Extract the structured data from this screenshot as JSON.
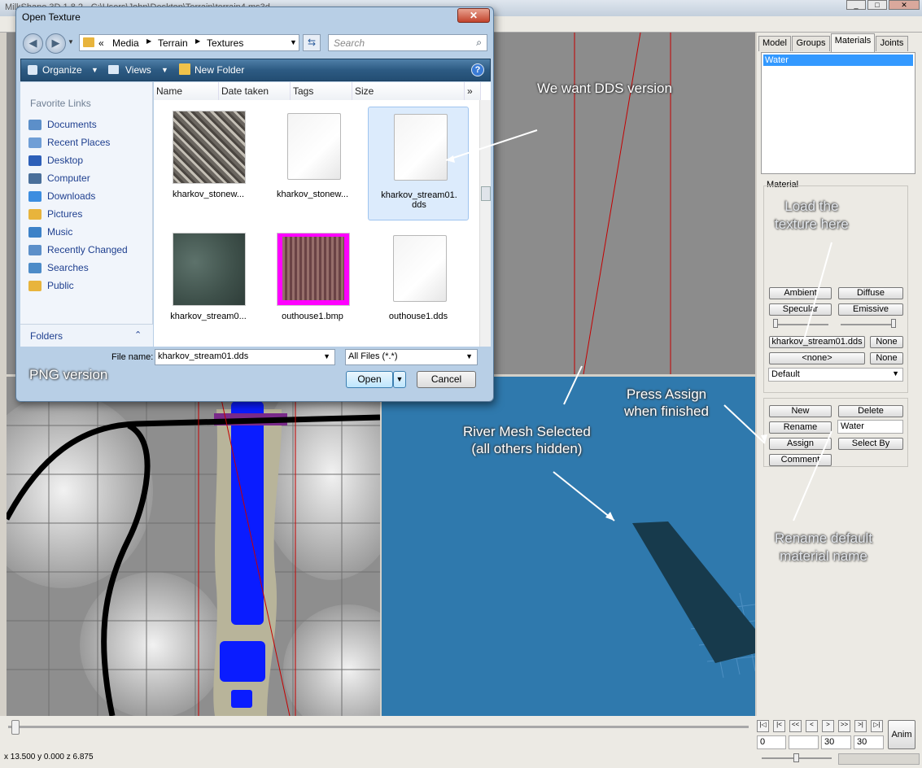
{
  "app": {
    "title": "MilkShape 3D 1.8.2 - C:\\Users\\John\\Desktop\\Terrain\\terrain4.ms3d",
    "minimize": "_",
    "maximize": "□",
    "close": "✕"
  },
  "panel": {
    "tabs": [
      "Model",
      "Groups",
      "Materials",
      "Joints"
    ],
    "materials_list": [
      "Water"
    ],
    "material_group_label": "Material",
    "buttons": {
      "ambient": "Ambient",
      "diffuse": "Diffuse",
      "specular": "Specular",
      "emissive": "Emissive",
      "texture": "kharkov_stream01.dds",
      "texture_none": "None",
      "alpha_map": "<none>",
      "alpha_none": "None",
      "mode": "Default",
      "new": "New",
      "delete": "Delete",
      "rename": "Rename",
      "assign": "Assign",
      "select_by": "Select By",
      "comment": "Comment"
    },
    "name_value": "Water"
  },
  "bottom": {
    "status": "x 13.500 y 0.000 z 6.875",
    "frame_current": "0",
    "frame_a": "30",
    "frame_b": "30",
    "anim": "Anim"
  },
  "dialog": {
    "title": "Open Texture",
    "close": "✕",
    "breadcrumb": [
      "Media",
      "Terrain",
      "Textures"
    ],
    "search_placeholder": "Search",
    "toolbar": {
      "organize": "Organize",
      "views": "Views",
      "new_folder": "New Folder"
    },
    "favorite_links_title": "Favorite Links",
    "nav_items": [
      {
        "label": "Documents",
        "color": "#5c8fc9"
      },
      {
        "label": "Recent Places",
        "color": "#6f9ed6"
      },
      {
        "label": "Desktop",
        "color": "#2d5fb8"
      },
      {
        "label": "Computer",
        "color": "#4a6f9a"
      },
      {
        "label": "Downloads",
        "color": "#3c8de0"
      },
      {
        "label": "Pictures",
        "color": "#e8b43c"
      },
      {
        "label": "Music",
        "color": "#3d82c8"
      },
      {
        "label": "Recently Changed",
        "color": "#5c8fc9"
      },
      {
        "label": "Searches",
        "color": "#4c8bc8"
      },
      {
        "label": "Public",
        "color": "#e8b43c"
      }
    ],
    "folders_label": "Folders",
    "columns": [
      "Name",
      "Date taken",
      "Tags",
      "Size"
    ],
    "files": [
      {
        "name": "kharkov_stonew...",
        "kind": "stone"
      },
      {
        "name": "kharkov_stonew...",
        "kind": "doc"
      },
      {
        "name": "kharkov_stream01.\ndds",
        "kind": "doc"
      },
      {
        "name": "kharkov_stream0...",
        "kind": "water"
      },
      {
        "name": "outhouse1.bmp",
        "kind": "bmp"
      },
      {
        "name": "outhouse1.dds",
        "kind": "doc"
      }
    ],
    "file_name_label": "File name:",
    "file_name_value": "kharkov_stream01.dds",
    "file_type_value": "All Files (*.*)",
    "open": "Open",
    "cancel": "Cancel"
  },
  "annotations": {
    "dds": "We want DDS version",
    "png": "PNG version",
    "load": "Load the\ntexture here",
    "assign": "Press Assign\nwhen finished",
    "river": "River Mesh Selected\n(all others hidden)",
    "rename": "Rename default\nmaterial name"
  }
}
